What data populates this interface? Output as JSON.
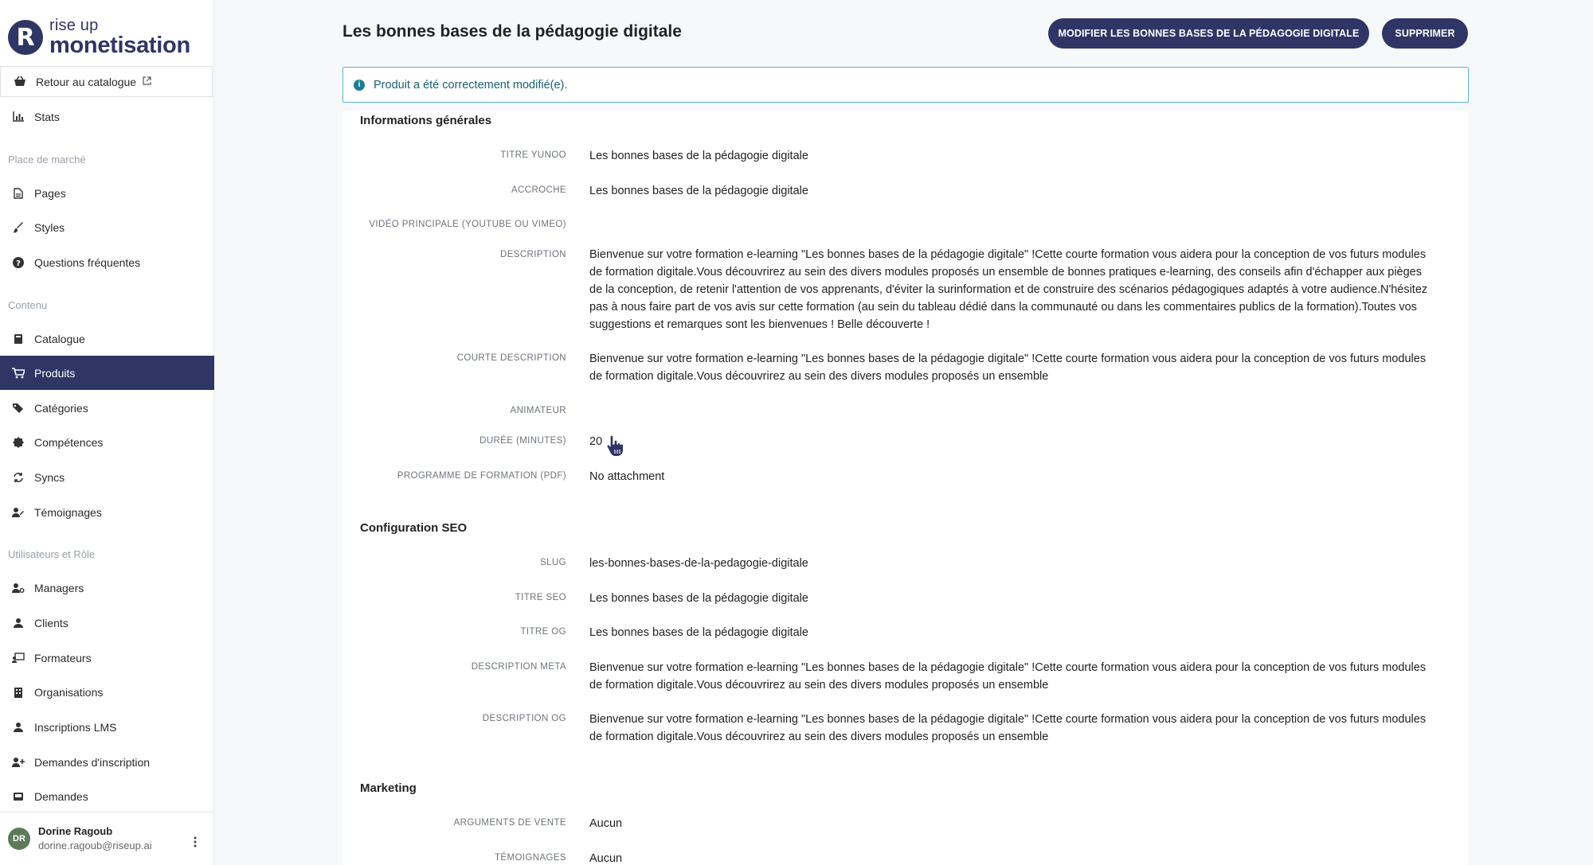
{
  "brand": {
    "line1": "rise up",
    "line2": "monetisation",
    "mark": "R"
  },
  "sidebar": {
    "back_link": "Retour au catalogue",
    "stats": "Stats",
    "section_marketplace": "Place de marché",
    "pages": "Pages",
    "styles": "Styles",
    "faq": "Questions fréquentes",
    "section_content": "Contenu",
    "catalogue": "Catalogue",
    "produits": "Produits",
    "categories": "Catégories",
    "competences": "Compétences",
    "syncs": "Syncs",
    "temoignages": "Témoignages",
    "section_users": "Utilisateurs et Rôle",
    "managers": "Managers",
    "clients": "Clients",
    "formateurs": "Formateurs",
    "organisations": "Organisations",
    "inscriptions": "Inscriptions LMS",
    "demandes_inscription": "Demandes d'inscription",
    "demandes": "Demandes"
  },
  "user": {
    "initials": "DR",
    "name": "Dorine Ragoub",
    "email": "dorine.ragoub@riseup.ai"
  },
  "header": {
    "title": "Les bonnes bases de la pédagogie digitale",
    "edit_button": "MODIFIER LES BONNES BASES DE LA PÉDAGOGIE DIGITALE",
    "delete_button": "SUPPRIMER"
  },
  "alert": {
    "message": "Produit a été correctement modifié(e)."
  },
  "general": {
    "title": "Informations générales",
    "titre_yunoo_label": "TITRE YUNOO",
    "titre_yunoo": "Les bonnes bases de la pédagogie digitale",
    "accroche_label": "ACCROCHE",
    "accroche": "Les bonnes bases de la pédagogie digitale",
    "video_label": "VIDÉO PRINCIPALE (YOUTUBE OU VIMEO)",
    "description_label": "DESCRIPTION",
    "description": "Bienvenue sur votre formation e-learning \"Les bonnes bases de la pédagogie digitale\" !Cette courte formation vous aidera pour la conception de vos futurs modules de formation digitale.Vous découvrirez au sein des divers modules proposés un ensemble de bonnes pratiques e-learning, des conseils afin d'échapper aux pièges de la conception, de retenir l'attention de vos apprenants, d'éviter la surinformation et de construire des scénarios pédagogiques adaptés à votre audience.N'hésitez pas à nous faire part de vos avis sur cette formation (au sein du tableau dédié dans la communauté ou dans les commentaires publics de la formation).Toutes vos suggestions et remarques sont les bienvenues ! Belle découverte !",
    "courte_label": "COURTE DESCRIPTION",
    "courte": "Bienvenue sur votre formation e-learning \"Les bonnes bases de la pédagogie digitale\" !Cette courte formation vous aidera pour la conception de vos futurs modules de formation digitale.Vous découvrirez au sein des divers modules proposés un ensemble",
    "animateur_label": "ANIMATEUR",
    "duree_label": "DURÉE (MINUTES)",
    "duree": "20",
    "programme_label": "PROGRAMME DE FORMATION (PDF)",
    "programme": "No attachment"
  },
  "seo": {
    "title": "Configuration SEO",
    "slug_label": "SLUG",
    "slug": "les-bonnes-bases-de-la-pedagogie-digitale",
    "titre_seo_label": "TITRE SEO",
    "titre_seo": "Les bonnes bases de la pédagogie digitale",
    "titre_og_label": "TITRE OG",
    "titre_og": "Les bonnes bases de la pédagogie digitale",
    "meta_label": "DESCRIPTION META",
    "meta": "Bienvenue sur votre formation e-learning \"Les bonnes bases de la pédagogie digitale\" !Cette courte formation vous aidera pour la conception de vos futurs modules de formation digitale.Vous découvrirez au sein des divers modules proposés un ensemble",
    "og_label": "DESCRIPTION OG",
    "og": "Bienvenue sur votre formation e-learning \"Les bonnes bases de la pédagogie digitale\" !Cette courte formation vous aidera pour la conception de vos futurs modules de formation digitale.Vous découvrirez au sein des divers modules proposés un ensemble"
  },
  "marketing": {
    "title": "Marketing",
    "arguments_label": "ARGUMENTS DE VENTE",
    "arguments": "Aucun",
    "temoignages_label": "TÉMOIGNAGES",
    "temoignages": "Aucun"
  },
  "colors": {
    "primary": "#2f3565",
    "alert_border": "#5ab6c6"
  }
}
